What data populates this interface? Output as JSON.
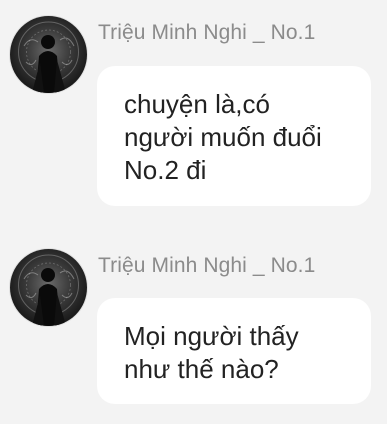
{
  "messages": [
    {
      "sender": "Triệu Minh Nghi _ No.1",
      "avatar_icon": "user-avatar-dark-figure",
      "text": "chuyện là,có\nngười muốn đuổi\nNo.2 đi"
    },
    {
      "sender": "Triệu Minh Nghi _ No.1",
      "avatar_icon": "user-avatar-dark-figure",
      "text": "Mọi người thấy\nnhư thế nào?"
    }
  ],
  "colors": {
    "background": "#f3f3f3",
    "bubble": "#ffffff",
    "sender_name": "#8b8b8b",
    "message_text": "#222222"
  }
}
